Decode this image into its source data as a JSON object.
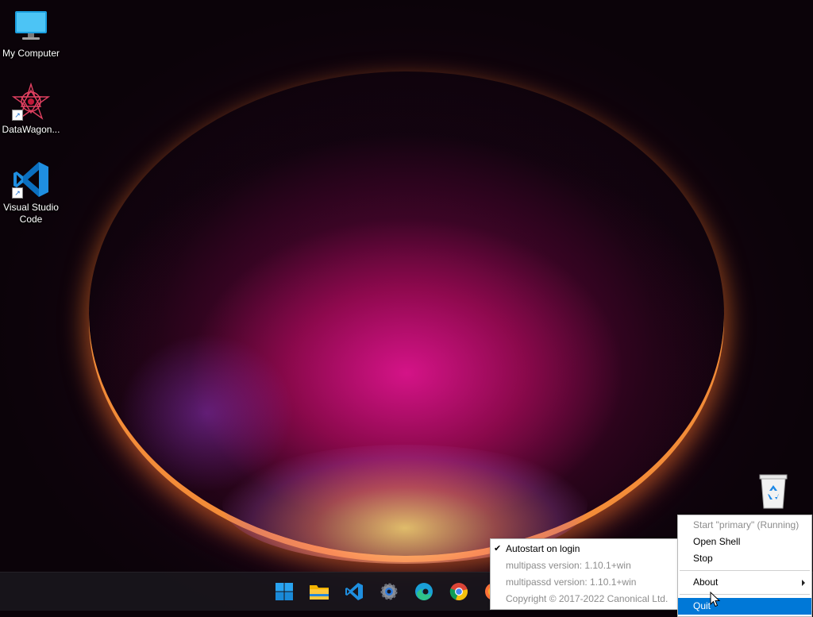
{
  "desktop": {
    "icons": [
      {
        "label": "My Computer",
        "icon": "computer-monitor-icon"
      },
      {
        "label": "DataWagon...",
        "icon": "datawagon-star-icon"
      },
      {
        "label": "Visual Studio Code",
        "icon": "vscode-icon"
      }
    ],
    "recycle_bin": {
      "icon": "recycle-bin-icon"
    }
  },
  "taskbar": {
    "items": [
      {
        "name": "start",
        "icon": "windows-start-icon"
      },
      {
        "name": "file-explorer",
        "icon": "folder-icon"
      },
      {
        "name": "vscode",
        "icon": "vscode-icon"
      },
      {
        "name": "settings",
        "icon": "gear-icon"
      },
      {
        "name": "edge",
        "icon": "edge-browser-icon"
      },
      {
        "name": "chrome",
        "icon": "chrome-browser-icon"
      },
      {
        "name": "firefox",
        "icon": "firefox-browser-icon"
      }
    ]
  },
  "tray_menu": {
    "items": [
      {
        "label": "Start \"primary\" (Running)",
        "enabled": false
      },
      {
        "label": "Open Shell",
        "enabled": true
      },
      {
        "label": "Stop",
        "enabled": true
      },
      {
        "label": "About",
        "enabled": true,
        "submenu": true
      },
      {
        "label": "Quit",
        "enabled": true,
        "highlighted": true
      }
    ]
  },
  "about_submenu": {
    "items": [
      {
        "label": "Autostart on login",
        "checked": true,
        "enabled": true
      },
      {
        "label": "multipass version: 1.10.1+win",
        "enabled": false
      },
      {
        "label": "multipassd version: 1.10.1+win",
        "enabled": false
      },
      {
        "label": "Copyright © 2017-2022 Canonical Ltd.",
        "enabled": false
      }
    ]
  },
  "colors": {
    "menu_highlight": "#0078d7",
    "disabled_text": "#8c8c8c"
  }
}
